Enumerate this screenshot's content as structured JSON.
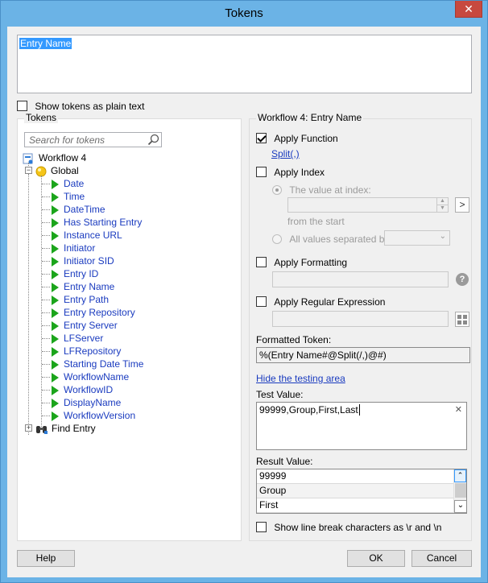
{
  "window": {
    "title": "Tokens",
    "close_glyph": "✕"
  },
  "token_text": "Entry Name",
  "show_plain_text": {
    "label": "Show tokens as plain text",
    "checked": false
  },
  "tokens_panel": {
    "title": "Tokens",
    "search_placeholder": "Search for tokens",
    "root": "Workflow 4",
    "global": "Global",
    "items": [
      "Date",
      "Time",
      "DateTime",
      "Has Starting Entry",
      "Instance URL",
      "Initiator",
      "Initiator SID",
      "Entry ID",
      "Entry Name",
      "Entry Path",
      "Entry Repository",
      "Entry Server",
      "LFServer",
      "LFRepository",
      "Starting Date Time",
      "WorkflowName",
      "WorkflowID",
      "DisplayName",
      "WorkflowVersion"
    ],
    "find_entry": "Find Entry"
  },
  "right_panel": {
    "title": "Workflow 4: Entry Name",
    "apply_function": "Apply Function",
    "function_link": "Split(,)",
    "apply_index": "Apply Index",
    "value_at_index": "The value at index:",
    "from_the_start": "from the  start",
    "all_values_separated": "All values separated by:",
    "index_next_glyph": ">",
    "apply_formatting": "Apply Formatting",
    "help_glyph": "?",
    "apply_regex": "Apply Regular Expression",
    "formatted_token_label": "Formatted Token:",
    "formatted_token_value": "%(Entry Name#@Split(/,)@#)",
    "hide_testing_link": "Hide the testing area",
    "test_value_label": "Test Value:",
    "test_value": "99999,Group,First,Last",
    "clear_glyph": "✕",
    "result_value_label": "Result Value:",
    "result_values": [
      "99999",
      "Group",
      "First"
    ],
    "show_line_breaks": "Show line break characters as \\r and \\n"
  },
  "buttons": {
    "help": "Help",
    "ok": "OK",
    "cancel": "Cancel"
  }
}
